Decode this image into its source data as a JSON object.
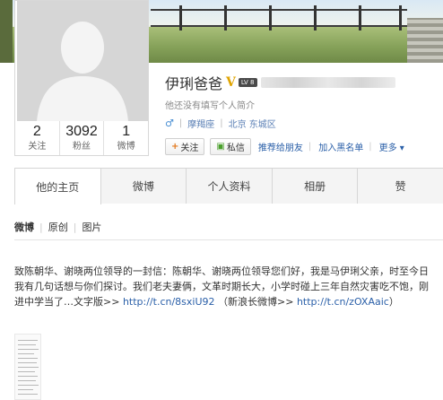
{
  "profile": {
    "name": "伊琍爸爸",
    "verified_badge": "V",
    "level_badge": "LV 8",
    "bio": "他还没有填写个人简介",
    "constellation": "摩羯座",
    "location": "北京 东城区",
    "stats": [
      {
        "value": "2",
        "label": "关注"
      },
      {
        "value": "3092",
        "label": "粉丝"
      },
      {
        "value": "1",
        "label": "微博"
      }
    ]
  },
  "actions": {
    "follow": "关注",
    "message": "私信",
    "recommend": "推荐给朋友",
    "blacklist": "加入黑名单",
    "more": "更多"
  },
  "tabs": [
    "他的主页",
    "微博",
    "个人资料",
    "相册",
    "赞"
  ],
  "subtabs": [
    "微博",
    "原创",
    "图片"
  ],
  "post": {
    "text": "致陈朝华、谢晓两位领导的一封信：陈朝华、谢晓两位领导您们好，我是马伊琍父亲，时至今日我有几句话想与你们探讨。我们老夫妻俩，文革时期长大，小学时碰上三年自然灾害吃不饱，刚进中学当了…文字版>>",
    "link1": "http://t.cn/8sxiU92",
    "paren_text": "（新浪长微博>>",
    "link2": "http://t.cn/zOXAaic",
    "close": "）"
  },
  "colors": {
    "link": "#2a5fa8",
    "verified": "#e0a400",
    "follow_plus": "#e3781c"
  }
}
